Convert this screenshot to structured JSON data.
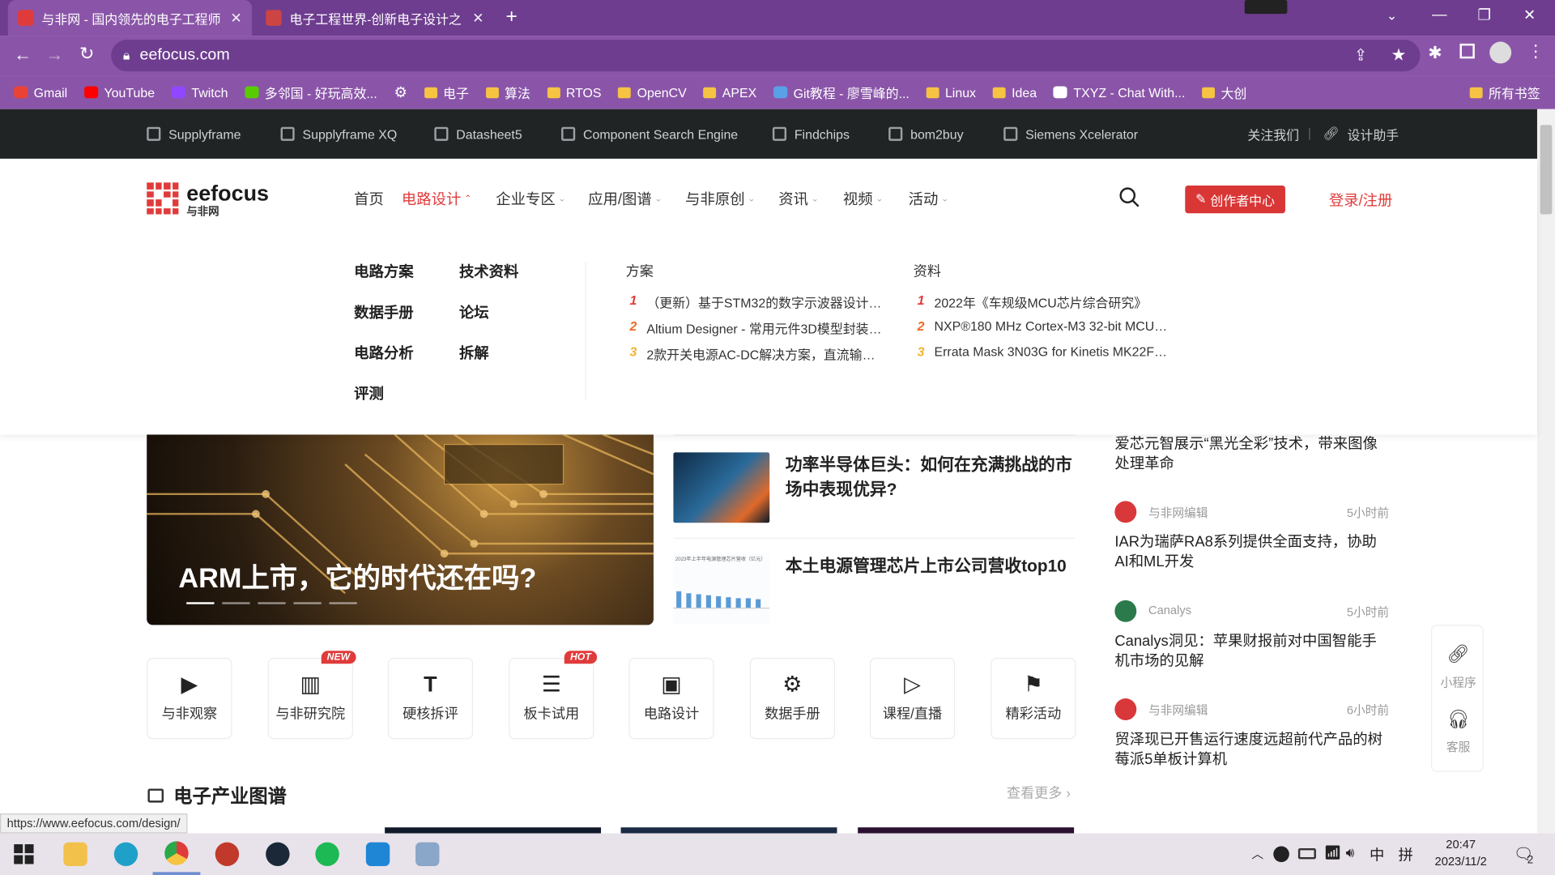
{
  "browser": {
    "tabs": [
      {
        "title": "与非网 - 国内领先的电子工程师"
      },
      {
        "title": "电子工程世界-创新电子设计之"
      }
    ],
    "address": "eefocus.com",
    "status_url": "https://www.eefocus.com/design/",
    "bookmarks": [
      {
        "label": "Gmail",
        "icon": "gmail-icon"
      },
      {
        "label": "YouTube",
        "icon": "youtube-icon"
      },
      {
        "label": "Twitch",
        "icon": "twitch-icon"
      },
      {
        "label": "多邻国 - 好玩高效...",
        "icon": "duolingo-icon"
      },
      {
        "label": "",
        "icon": "gear-icon"
      },
      {
        "label": "电子",
        "icon": "folder-icon"
      },
      {
        "label": "算法",
        "icon": "folder-icon"
      },
      {
        "label": "RTOS",
        "icon": "folder-icon"
      },
      {
        "label": "OpenCV",
        "icon": "folder-icon"
      },
      {
        "label": "APEX",
        "icon": "folder-icon"
      },
      {
        "label": "Git教程 - 廖雪峰的...",
        "icon": "git-icon"
      },
      {
        "label": "Linux",
        "icon": "folder-icon"
      },
      {
        "label": "Idea",
        "icon": "folder-icon"
      },
      {
        "label": "TXYZ - Chat With...",
        "icon": "txyz-icon"
      },
      {
        "label": "大创",
        "icon": "folder-icon"
      }
    ],
    "all_bookmarks": "所有书签"
  },
  "sitebar": {
    "links": [
      "Supplyframe",
      "Supplyframe XQ",
      "Datasheet5",
      "Component Search Engine",
      "Findchips",
      "bom2buy",
      "Siemens Xcelerator"
    ],
    "follow": "关注我们",
    "assistant": "设计助手"
  },
  "header": {
    "logo": "eefocus",
    "logo_sub": "与非网",
    "nav": [
      "首页",
      "电路设计",
      "企业专区",
      "应用/图谱",
      "与非原创",
      "资讯",
      "视频",
      "活动"
    ],
    "creator_btn": "创作者中心",
    "login": "登录/注册"
  },
  "dropdown": {
    "col1": [
      "电路方案",
      "数据手册",
      "电路分析",
      "评测"
    ],
    "col2": [
      "技术资料",
      "论坛",
      "拆解"
    ],
    "solutions_title": "方案",
    "solutions": [
      {
        "rank": "1",
        "text": "（更新）基于STM32的数字示波器设计（..."
      },
      {
        "rank": "2",
        "text": "Altium Designer - 常用元件3D模型封装库..."
      },
      {
        "rank": "3",
        "text": "2款开关电源AC-DC解决方案，直流输出D..."
      }
    ],
    "docs_title": "资料",
    "docs": [
      {
        "rank": "1",
        "text": "2022年《车规级MCU芯片综合研究》"
      },
      {
        "rank": "2",
        "text": "NXP®180 MHz Cortex-M3 32-bit MCUs L..."
      },
      {
        "rank": "3",
        "text": "Errata Mask 3N03G for Kinetis MK22FN1..."
      }
    ]
  },
  "feature": {
    "title": "ARM上市，它的时代还在吗?"
  },
  "articles": [
    {
      "title": "功率半导体巨头：如何在充满挑战的市场中表现优异?"
    },
    {
      "title": "本土电源管理芯片上市公司营收top10"
    }
  ],
  "quick": [
    {
      "label": "与非观察",
      "icon": "video-icon",
      "badge": ""
    },
    {
      "label": "与非研究院",
      "icon": "bar-chart-icon",
      "badge": "NEW"
    },
    {
      "label": "硬核拆评",
      "icon": "text-tool-icon",
      "badge": ""
    },
    {
      "label": "板卡试用",
      "icon": "sliders-icon",
      "badge": "HOT"
    },
    {
      "label": "电路设计",
      "icon": "chip-icon",
      "badge": ""
    },
    {
      "label": "数据手册",
      "icon": "gear-doc-icon",
      "badge": ""
    },
    {
      "label": "课程/直播",
      "icon": "monitor-play-icon",
      "badge": ""
    },
    {
      "label": "精彩活动",
      "icon": "flag-icon",
      "badge": ""
    }
  ],
  "section": {
    "title": "电子产业图谱",
    "more": "查看更多"
  },
  "news": [
    {
      "author": "",
      "time": "",
      "title": "爱芯元智展示“黑光全彩”技术，带来图像处理革命"
    },
    {
      "author": "与非网编辑",
      "time": "5小时前",
      "title": "IAR为瑞萨RA8系列提供全面支持，协助AI和ML开发"
    },
    {
      "author": "Canalys",
      "time": "5小时前",
      "title": "Canalys洞见：苹果财报前对中国智能手机市场的见解"
    },
    {
      "author": "与非网编辑",
      "time": "6小时前",
      "title": "贸泽现已开售运行速度远超前代产品的树莓派5单板计算机"
    }
  ],
  "float": {
    "miniprogram": "小程序",
    "service": "客服"
  },
  "chart_thumb": {
    "title": "2023年上半年电源管理芯片营收（亿元）"
  },
  "taskbar": {
    "time": "20:47",
    "date": "2023/11/2",
    "ime1": "中",
    "ime2": "拼",
    "notif": "2"
  }
}
